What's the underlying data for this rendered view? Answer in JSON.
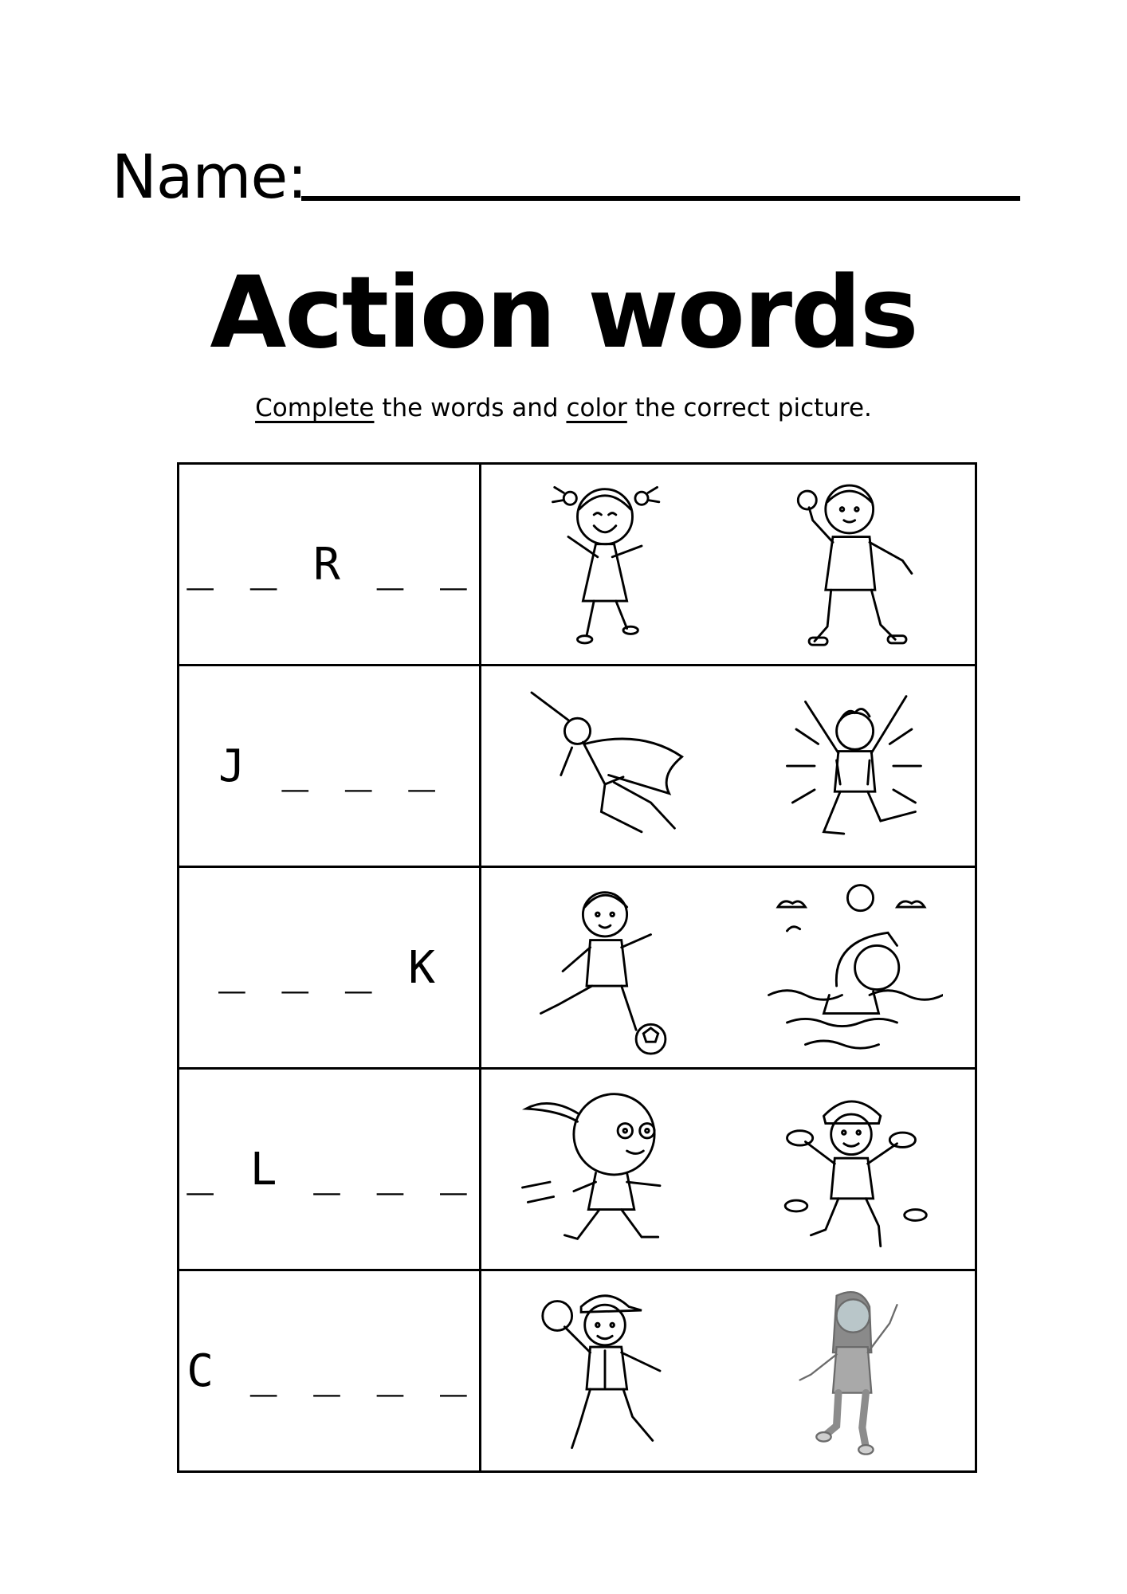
{
  "header": {
    "name_label": "Name:"
  },
  "title": "Action words",
  "instructions": {
    "word1": "Complete",
    "mid1": " the words and ",
    "word2": "color",
    "mid2": " the correct picture."
  },
  "rows": [
    {
      "word": "_ _ R _ _",
      "pictures": [
        "girl-dancing-illustration",
        "boy-throwing-ball-illustration"
      ]
    },
    {
      "word": "J _ _ _",
      "pictures": [
        "superhero-flying-illustration",
        "boy-jumping-illustration"
      ]
    },
    {
      "word": "_ _ _ K",
      "pictures": [
        "boy-kicking-ball-illustration",
        "boy-swimming-illustration"
      ]
    },
    {
      "word": "_ L _ _ _",
      "pictures": [
        "girl-running-illustration",
        "boy-climbing-illustration"
      ]
    },
    {
      "word": "C _ _ _ _",
      "pictures": [
        "boy-catching-ball-illustration",
        "girl-walking-illustration"
      ]
    }
  ]
}
